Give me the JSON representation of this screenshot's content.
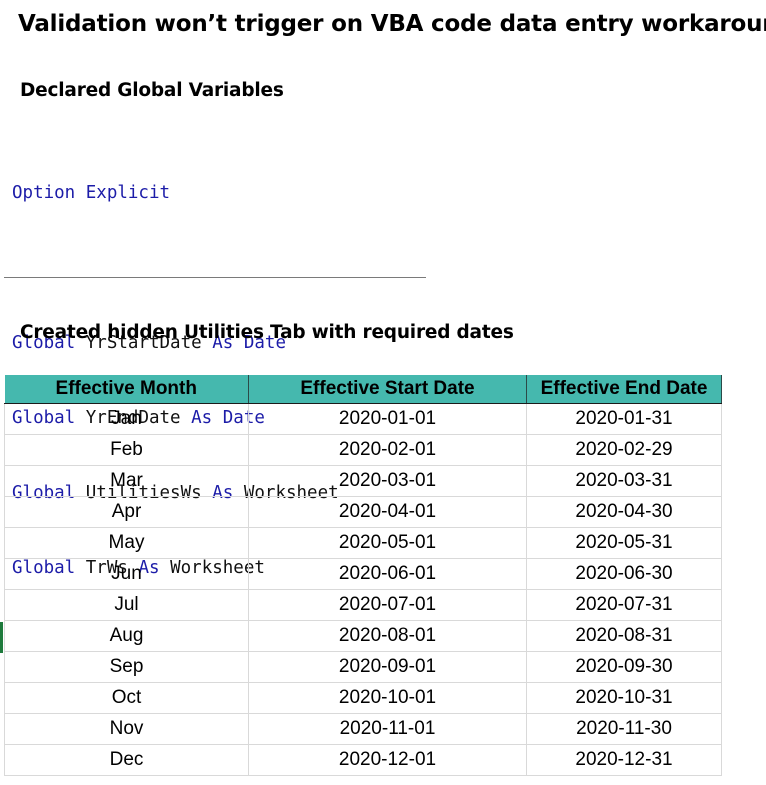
{
  "title": "Validation won’t trigger on VBA code data entry workaround",
  "sections": {
    "globals_heading": "Declared Global Variables",
    "utilities_heading": "Created hidden  Utilities Tab with required dates"
  },
  "code": {
    "option_keyword": "Option Explicit",
    "declarations": [
      {
        "scope": "Global",
        "name": "YrStartDate",
        "as": "As",
        "type": "Date"
      },
      {
        "scope": "Global",
        "name": "YrEndDate",
        "as": "As",
        "type": "Date"
      },
      {
        "scope": "Global",
        "name": "UtilitiesWs",
        "as": "As",
        "type": "Worksheet"
      },
      {
        "scope": "Global",
        "name": "TrWs",
        "as": "As",
        "type": "Worksheet"
      }
    ]
  },
  "table": {
    "columns": [
      "Effective Month",
      "Effective Start Date",
      "Effective End Date"
    ],
    "rows": [
      [
        "Jan",
        "2020-01-01",
        "2020-01-31"
      ],
      [
        "Feb",
        "2020-02-01",
        "2020-02-29"
      ],
      [
        "Mar",
        "2020-03-01",
        "2020-03-31"
      ],
      [
        "Apr",
        "2020-04-01",
        "2020-04-30"
      ],
      [
        "May",
        "2020-05-01",
        "2020-05-31"
      ],
      [
        "Jun",
        "2020-06-01",
        "2020-06-30"
      ],
      [
        "Jul",
        "2020-07-01",
        "2020-07-31"
      ],
      [
        "Aug",
        "2020-08-01",
        "2020-08-31"
      ],
      [
        "Sep",
        "2020-09-01",
        "2020-09-30"
      ],
      [
        "Oct",
        "2020-10-01",
        "2020-10-31"
      ],
      [
        "Nov",
        "2020-11-01",
        "2020-11-30"
      ],
      [
        "Dec",
        "2020-12-01",
        "2020-12-31"
      ]
    ]
  },
  "colors": {
    "header_fill": "#45b8ae",
    "code_keyword": "#1c1ca8",
    "code_identifier": "#111111"
  }
}
